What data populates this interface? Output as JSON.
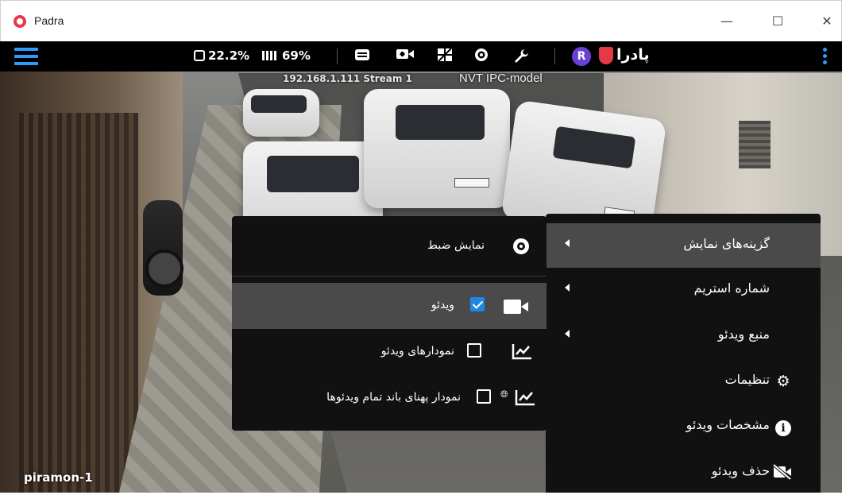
{
  "window": {
    "title": "Padra",
    "minimize_icon": "minimize-icon",
    "maximize_icon": "maximize-icon",
    "close_icon": "close-icon"
  },
  "toolbar": {
    "cpu_usage": "22.2%",
    "memory_usage": "69%",
    "avatar_letter": "R",
    "brand": "پادرا",
    "icons": [
      "menu-icon",
      "cpu-icon",
      "memory-icon",
      "layout-icon",
      "video-add-icon",
      "grid-icon",
      "record-icon",
      "wrench-icon",
      "more-vert-icon"
    ],
    "accent_color": "#2f9bff"
  },
  "camera": {
    "stream_info": "192.168.1.111 Stream 1",
    "model": "NVT IPC-model",
    "name": "piramon-1"
  },
  "main_menu": {
    "items": [
      {
        "label": "گزینه‌های نمایش",
        "has_submenu": true,
        "active": true
      },
      {
        "label": "شماره استریم",
        "has_submenu": true
      },
      {
        "label": "منبع ویدئو",
        "has_submenu": true
      },
      {
        "label": "تنظیمات",
        "icon": "gear-icon"
      },
      {
        "label": "مشخصات ویدئو",
        "icon": "info-icon"
      },
      {
        "label": "حذف ویدئو",
        "icon": "video-off-icon"
      }
    ]
  },
  "sub_menu": {
    "items": [
      {
        "label": "نمایش ضبط",
        "icon": "record-icon"
      },
      {
        "label": "ویدئو",
        "checked": true,
        "icon": "video-icon",
        "active": true
      },
      {
        "label": "نمودارهای ویدئو",
        "checked": false,
        "icon": "chart-icon"
      },
      {
        "label": "نمودار پهنای باند تمام ویدئوها",
        "checked": false,
        "icon": "chart-globe-icon"
      }
    ]
  },
  "colors": {
    "menu_bg": "#111111",
    "menu_active": "#4a4a4a",
    "checkbox_checked": "#1e88e5",
    "brand_red": "#e63946",
    "avatar_purple": "#6a3fd6"
  }
}
